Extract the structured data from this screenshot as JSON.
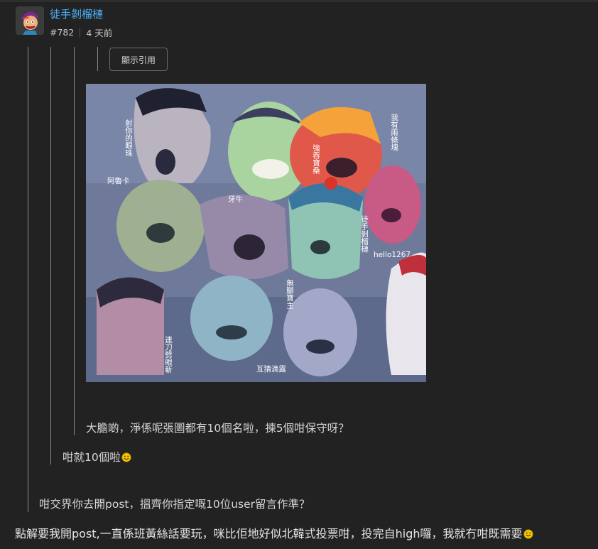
{
  "post": {
    "username": "徒手剝榴槤",
    "post_number": "#782",
    "time_ago": "4 天前",
    "avatar_icon": "cartoon-avatar-icon"
  },
  "quote": {
    "show_quote_label": "顯示引用",
    "level3_text": "大膽啲，淨係呢張圖都有10個名啦，揀5個咁保守呀？",
    "level2_text": "咁就10個啦",
    "level1_text": "咁交界你去開post，搵齊你指定嘅10位user留言作準？"
  },
  "image": {
    "labels": {
      "top_left": "射你的眼珠",
      "left": "阿魯卡",
      "center": "牙牛",
      "red_face": "強吞寶桑",
      "top_right": "我有兩條塊",
      "right": "徒手剝榴槤",
      "hello": "hello1267",
      "middle": "無腳寶主",
      "bottom_left": "連刀劈眼斬",
      "bottom_center": "互猜滴露"
    }
  },
  "reply": {
    "text": "點解要我開post,一直係班黃絲話要玩，咪比佢地好似北韓式投票咁，投完自high囉，我就冇咁既需要"
  },
  "colors": {
    "background": "#222222",
    "username": "#4fb3ff",
    "quote_line": "#8a8a8a",
    "smiley": "#f5c400"
  }
}
